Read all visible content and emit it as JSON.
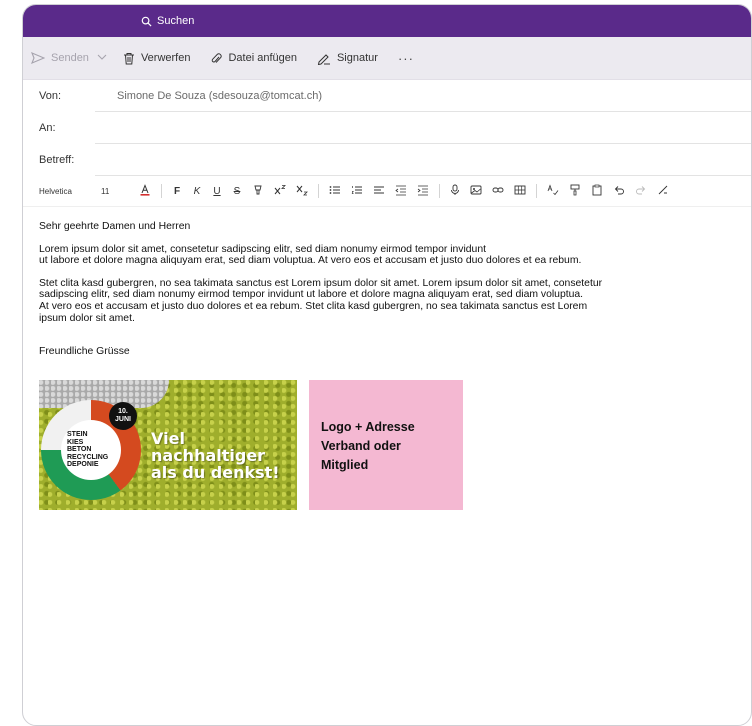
{
  "header": {
    "search_label": "Suchen"
  },
  "toolbar": {
    "send_label": "Senden",
    "discard_label": "Verwerfen",
    "attach_label": "Datei anfügen",
    "signature_label": "Signatur",
    "more_label": "···"
  },
  "fields": {
    "from_label": "Von:",
    "from_value": "Simone De Souza (sdesouza@tomcat.ch)",
    "to_label": "An:",
    "subject_label": "Betreff:"
  },
  "format": {
    "font": "Helvetica",
    "size": "11",
    "bold": "F",
    "italic": "K",
    "underline": "U",
    "strike": "S"
  },
  "message": {
    "greeting": "Sehr geehrte Damen und Herren",
    "para1": [
      "Lorem ipsum dolor sit amet, consetetur sadipscing elitr, sed diam nonumy eirmod tempor invidunt",
      "ut labore et dolore magna aliquyam erat, sed diam voluptua. At vero eos et accusam et justo duo dolores et ea rebum."
    ],
    "para2": [
      "Stet clita kasd gubergren, no sea takimata sanctus est Lorem ipsum dolor sit amet. Lorem ipsum dolor sit amet, consetetur",
      "sadipscing elitr, sed diam nonumy eirmod tempor invidunt ut labore et dolore magna aliquyam erat, sed diam voluptua.",
      "At vero eos et accusam et justo duo dolores et ea rebum. Stet clita kasd gubergren, no sea takimata sanctus est Lorem",
      "ipsum dolor sit amet."
    ],
    "closing": "Freundliche Grüsse"
  },
  "banner": {
    "badge_lines": [
      "STEIN",
      "KIES",
      "BETON",
      "RECYCLING",
      "DEPONIE"
    ],
    "date_lines": [
      "10.",
      "JUNI"
    ],
    "slogan_lines": [
      "Viel nachhaltiger",
      "als du denkst!"
    ]
  },
  "placeholder": {
    "lines": [
      "Logo + Adresse",
      "Verband oder",
      "Mitglied"
    ]
  },
  "colors": {
    "topbar": "#5a2a8a",
    "toolbar_bg": "#eceaf0",
    "placeholder_bg": "#f4b8d2",
    "banner_green": "#9fae2c"
  }
}
